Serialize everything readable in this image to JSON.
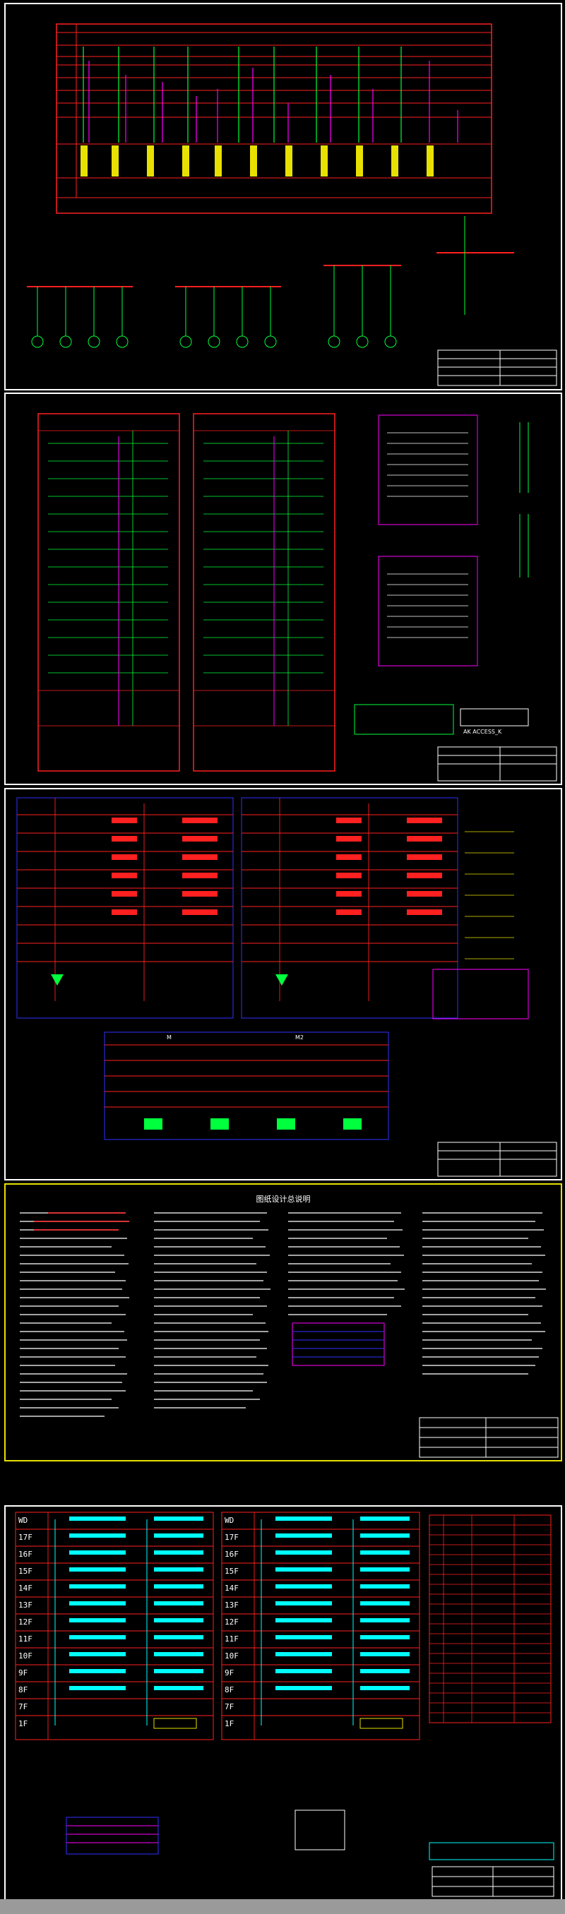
{
  "sheet4": {
    "title": "图纸设计总说明"
  },
  "floors": {
    "left": [
      "WD",
      "17F",
      "16F",
      "15F",
      "14F",
      "13F",
      "12F",
      "11F",
      "10F",
      "9F",
      "8F",
      "7F",
      "1F"
    ],
    "right": [
      "WD",
      "17F",
      "16F",
      "15F",
      "14F",
      "13F",
      "12F",
      "11F",
      "10F",
      "9F",
      "8F",
      "7F",
      "1F"
    ]
  },
  "sheet2": {
    "box_label": "AK ACCESS_K"
  },
  "sheet3": {
    "tags": [
      "M",
      "M2"
    ]
  },
  "colors": {
    "border": "#ffffff",
    "red": "#ff2020",
    "green": "#00ff3c",
    "magenta": "#ff00ff",
    "cyan": "#00ffff",
    "yellow": "#e8e000",
    "blue": "#3030ff"
  }
}
